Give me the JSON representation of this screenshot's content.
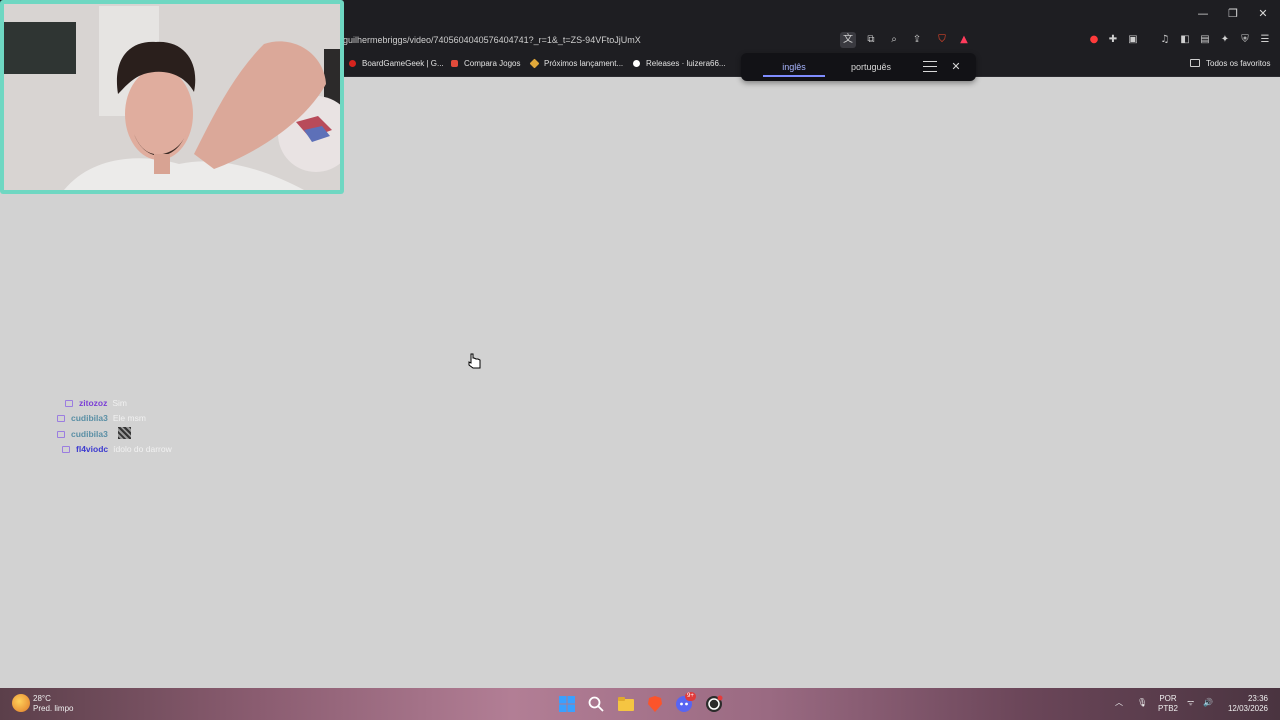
{
  "browser": {
    "url": "guilhermebriggs/video/7405604040576404741?_r=1&_t=ZS-94VFtoJjUmX",
    "window_controls": {
      "minimize": "—",
      "restore": "❐",
      "close": "✕"
    }
  },
  "bookmarks": {
    "items": [
      {
        "label": "BoardGameGeek | G...",
        "color": "#d6241e"
      },
      {
        "label": "Compara Jogos",
        "color": "#e24b3b"
      },
      {
        "label": "Próximos lançament...",
        "color": "#e0a83a"
      },
      {
        "label": "Releases · luizera66...",
        "color": "#ffffff"
      }
    ],
    "all_bookmarks": "Todos os favoritos"
  },
  "translate_popup": {
    "source_language": "inglês",
    "target_language": "português"
  },
  "chat": [
    {
      "user": "zitozoz",
      "message": "Sim",
      "user_color": "#7b3fd6"
    },
    {
      "user": "cudibila3",
      "message": "Ele msm",
      "user_color": "#5a8fa5"
    },
    {
      "user": "cudibila3",
      "message": "",
      "user_color": "#5a8fa5"
    },
    {
      "user": "fl4viodc",
      "message": "ídolo do darrow",
      "user_color": "#3c3ad0"
    }
  ],
  "taskbar": {
    "weather": {
      "temperature": "28°C",
      "condition": "Pred. limpo"
    },
    "language": {
      "line1": "POR",
      "line2": "PTB2"
    },
    "clock": {
      "time": "23:36",
      "date": "12/03/2026"
    },
    "discord_badge": "9+"
  },
  "colors": {
    "page_background": "#d2d2d2",
    "chrome": "#1e1e22",
    "webcam_border": "#6fd7c2",
    "translate_accent": "#7f8dff"
  }
}
